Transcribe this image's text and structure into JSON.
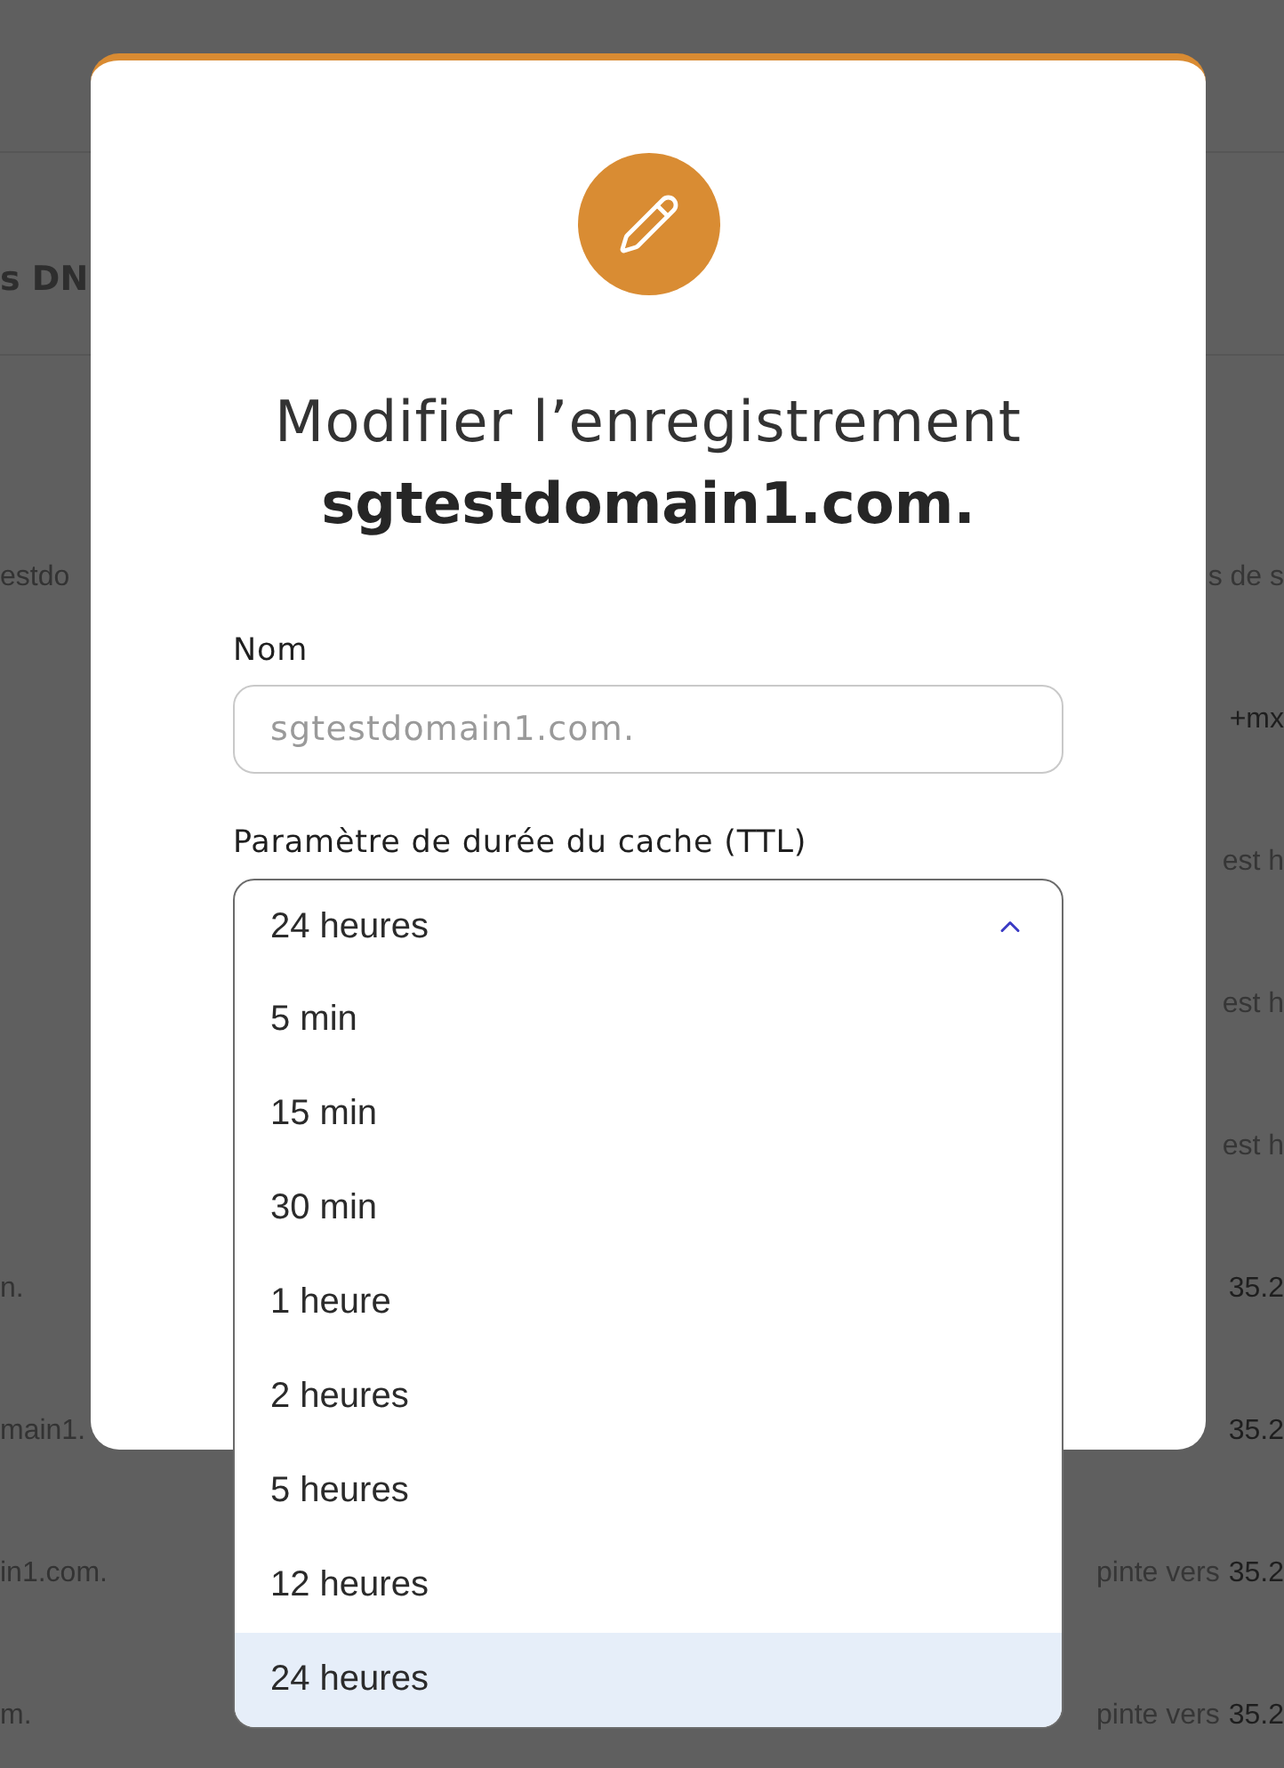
{
  "background": {
    "heading": "s DN",
    "rows": [
      {
        "left": "estdo",
        "right": [
          {
            "text": "s de s",
            "muted": true
          }
        ]
      },
      {
        "right": [
          {
            "text": "+mx",
            "muted": false
          }
        ]
      },
      {
        "right": [
          {
            "text": "est h",
            "muted": true
          }
        ]
      },
      {
        "right": [
          {
            "text": "est h",
            "muted": true
          }
        ]
      },
      {
        "right": [
          {
            "text": "est h",
            "muted": true
          }
        ]
      },
      {
        "left": "n.",
        "right": [
          {
            "text": "35.2",
            "muted": false
          }
        ]
      },
      {
        "left": "main1.",
        "right": [
          {
            "text": "35.2",
            "muted": false
          }
        ]
      },
      {
        "left": "in1.com.",
        "right": [
          {
            "text": "pinte vers",
            "muted": true
          },
          {
            "text": "35.2",
            "muted": false
          }
        ]
      },
      {
        "left": "m.",
        "right": [
          {
            "text": "pinte vers",
            "muted": true
          },
          {
            "text": "35.2",
            "muted": false
          }
        ]
      }
    ]
  },
  "dialog": {
    "title": "Modifier l’enregistrement **sgtestdomain1.com.**",
    "name_field": {
      "label": "Nom",
      "placeholder": "sgtestdomain1.com."
    },
    "ttl": {
      "label": "Paramètre de durée du cache (TTL)",
      "value": "24 heures",
      "expanded": true,
      "options": [
        {
          "label": "5 min",
          "selected": false
        },
        {
          "label": "15 min",
          "selected": false
        },
        {
          "label": "30 min",
          "selected": false
        },
        {
          "label": "1 heure",
          "selected": false
        },
        {
          "label": "2 heures",
          "selected": false
        },
        {
          "label": "5 heures",
          "selected": false
        },
        {
          "label": "12 heures",
          "selected": false
        },
        {
          "label": "24 heures",
          "selected": true
        }
      ]
    }
  }
}
